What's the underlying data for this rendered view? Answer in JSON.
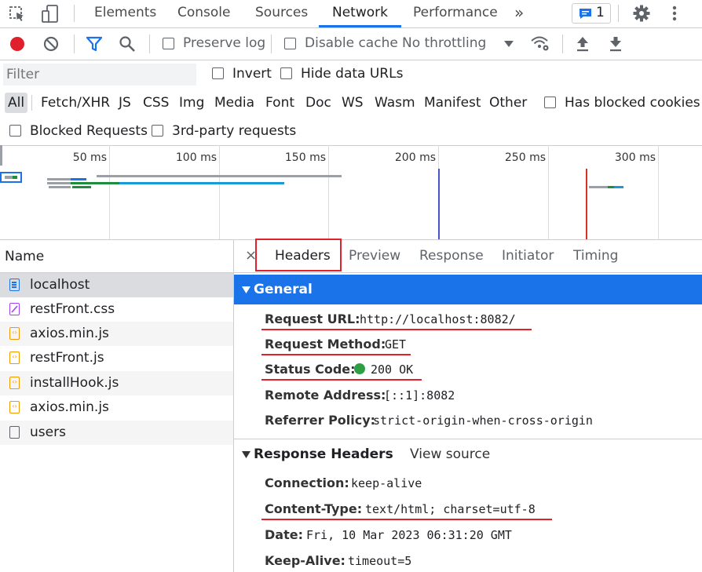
{
  "tabs": [
    "Elements",
    "Console",
    "Sources",
    "Network",
    "Performance"
  ],
  "active_tab": "Network",
  "more_tabs_glyph": "»",
  "messages_count": "1",
  "toolbar": {
    "preserve_log": "Preserve log",
    "disable_cache": "Disable cache",
    "throttling": "No throttling"
  },
  "filter": {
    "placeholder": "Filter",
    "invert": "Invert",
    "hide_data_urls": "Hide data URLs",
    "types": [
      "All",
      "Fetch/XHR",
      "JS",
      "CSS",
      "Img",
      "Media",
      "Font",
      "Doc",
      "WS",
      "Wasm",
      "Manifest",
      "Other"
    ],
    "selected_type": "All",
    "has_blocked_cookies": "Has blocked cookies",
    "blocked_requests": "Blocked Requests",
    "third_party": "3rd-party requests"
  },
  "timeline": {
    "ticks": [
      "50 ms",
      "100 ms",
      "150 ms",
      "200 ms",
      "250 ms",
      "300 ms"
    ]
  },
  "requests": {
    "header": "Name",
    "items": [
      {
        "name": "localhost",
        "type": "document"
      },
      {
        "name": "restFront.css",
        "type": "stylesheet"
      },
      {
        "name": "axios.min.js",
        "type": "script"
      },
      {
        "name": "restFront.js",
        "type": "script"
      },
      {
        "name": "installHook.js",
        "type": "script"
      },
      {
        "name": "axios.min.js",
        "type": "script"
      },
      {
        "name": "users",
        "type": "fetch"
      }
    ]
  },
  "details": {
    "close_glyph": "×",
    "tabs": [
      "Headers",
      "Preview",
      "Response",
      "Initiator",
      "Timing"
    ],
    "active_tab": "Headers",
    "general": {
      "title": "General",
      "rows": [
        {
          "key": "Request URL:",
          "value": "http://localhost:8082/"
        },
        {
          "key": "Request Method:",
          "value": "GET"
        },
        {
          "key": "Status Code:",
          "value": "200 OK"
        },
        {
          "key": "Remote Address:",
          "value": "[::1]:8082"
        },
        {
          "key": "Referrer Policy:",
          "value": "strict-origin-when-cross-origin"
        }
      ]
    },
    "response_headers": {
      "title": "Response Headers",
      "view_source": "View source",
      "rows": [
        {
          "key": "Connection:",
          "value": "keep-alive"
        },
        {
          "key": "Content-Type:",
          "value": "text/html; charset=utf-8"
        },
        {
          "key": "Date:",
          "value": "Fri, 10 Mar 2023 06:31:20 GMT"
        },
        {
          "key": "Keep-Alive:",
          "value": "timeout=5"
        }
      ]
    }
  },
  "colors": {
    "accent": "#1a73e8",
    "record": "#e0202a",
    "annotation": "#e0202a",
    "status_ok": "#2ea043"
  }
}
